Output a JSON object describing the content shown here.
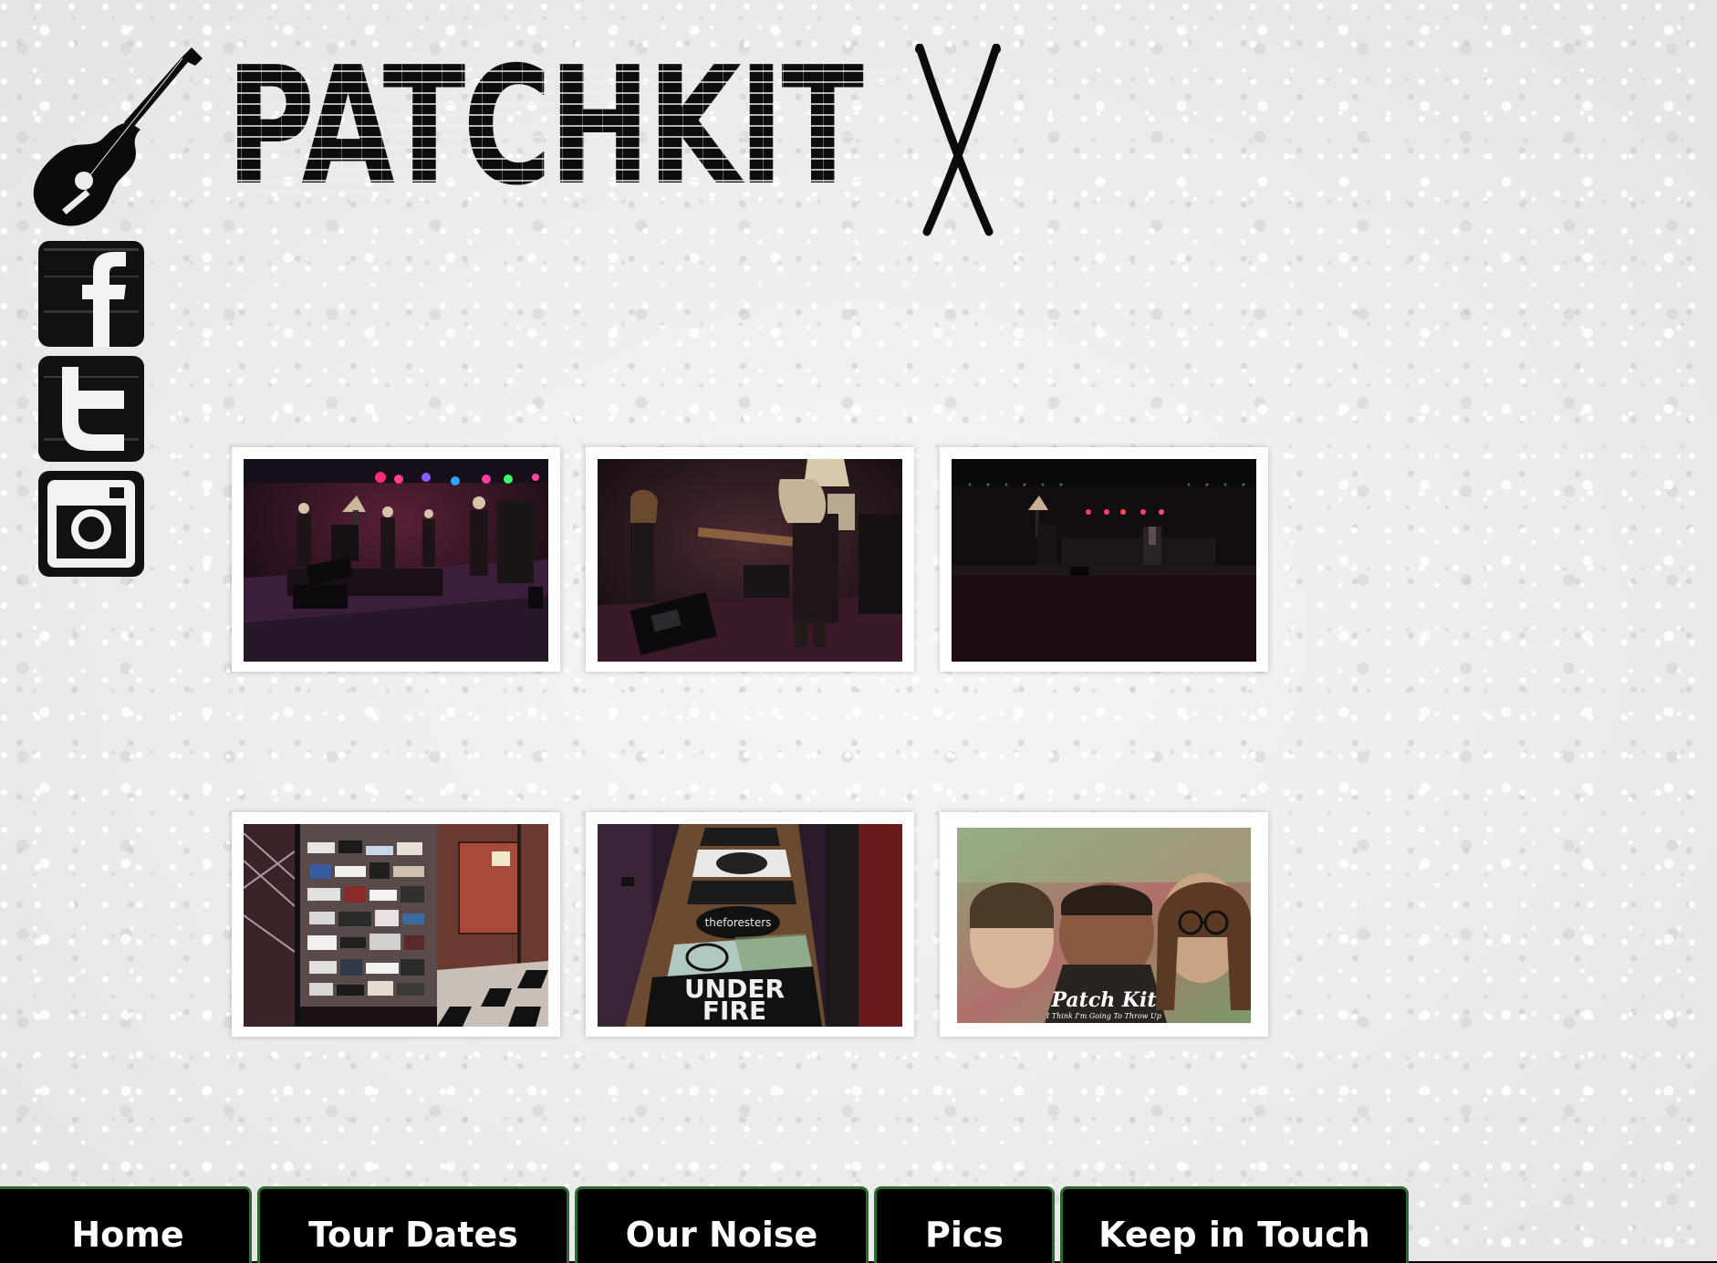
{
  "header": {
    "logo_text": "PATCHKIT",
    "guitar_icon": "guitar-icon",
    "drumsticks_icon": "drumsticks-icon"
  },
  "social": [
    {
      "name": "facebook",
      "icon": "facebook-icon"
    },
    {
      "name": "twitter",
      "icon": "twitter-icon"
    },
    {
      "name": "instagram",
      "icon": "instagram-icon"
    }
  ],
  "gallery": {
    "photos": [
      {
        "subject": "band-on-stage-wide"
      },
      {
        "subject": "band-on-stage-closeup"
      },
      {
        "subject": "empty-stage"
      },
      {
        "subject": "sticker-covered-door"
      },
      {
        "subject": "stickers-on-bar"
      },
      {
        "subject": "album-cover",
        "title": "Patch Kit",
        "subtitle": "I Think I'm Going To Throw Up"
      }
    ],
    "sticker_text_1": "UNDER",
    "sticker_text_2": "FIRE",
    "sticker_text_3": "theforesters"
  },
  "nav": {
    "items": [
      {
        "label": "Home"
      },
      {
        "label": "Tour Dates"
      },
      {
        "label": "Our Noise"
      },
      {
        "label": "Pics"
      },
      {
        "label": "Keep in Touch"
      }
    ]
  },
  "colors": {
    "nav_background": "#000000",
    "nav_border": "#2d6b2d",
    "nav_text": "#ffffff",
    "page_background": "#ececec"
  }
}
